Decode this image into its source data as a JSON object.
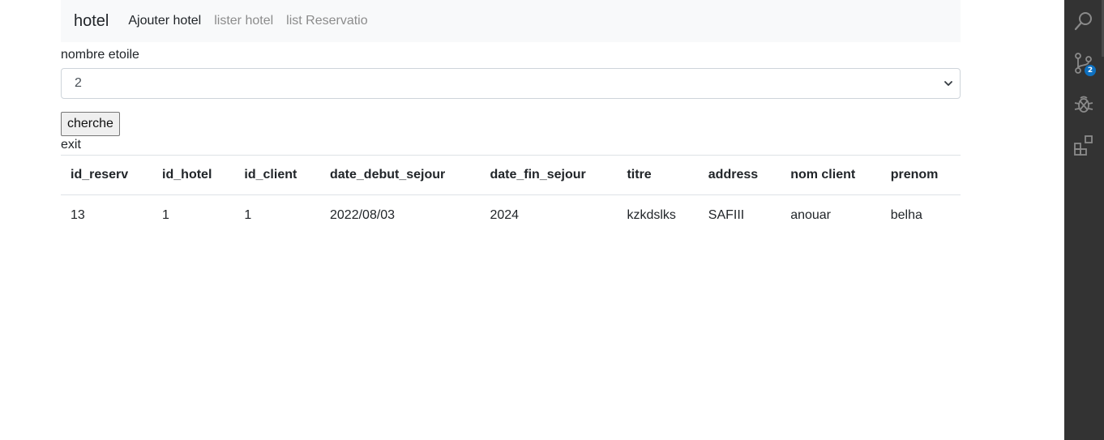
{
  "navbar": {
    "brand": "hotel",
    "links": [
      {
        "label": "Ajouter hotel",
        "active": true
      },
      {
        "label": "lister hotel",
        "active": false
      },
      {
        "label": "list Reservatio",
        "active": false
      }
    ]
  },
  "filter": {
    "label": "nombre etoile",
    "selected_value": "2",
    "search_button": "cherche",
    "exit_label": "exit"
  },
  "table": {
    "headers": [
      "id_reserv",
      "id_hotel",
      "id_client",
      "date_debut_sejour",
      "date_fin_sejour",
      "titre",
      "address",
      "nom client",
      "prenom"
    ],
    "rows": [
      [
        "13",
        "1",
        "1",
        "2022/08/03",
        "2024",
        "kzkdslks",
        "SAFIII",
        "anouar",
        "belha"
      ]
    ]
  },
  "activity_bar": {
    "icons": [
      "search-icon",
      "source-control-icon",
      "debug-icon",
      "extensions-icon"
    ],
    "source_control_badge": "2"
  }
}
